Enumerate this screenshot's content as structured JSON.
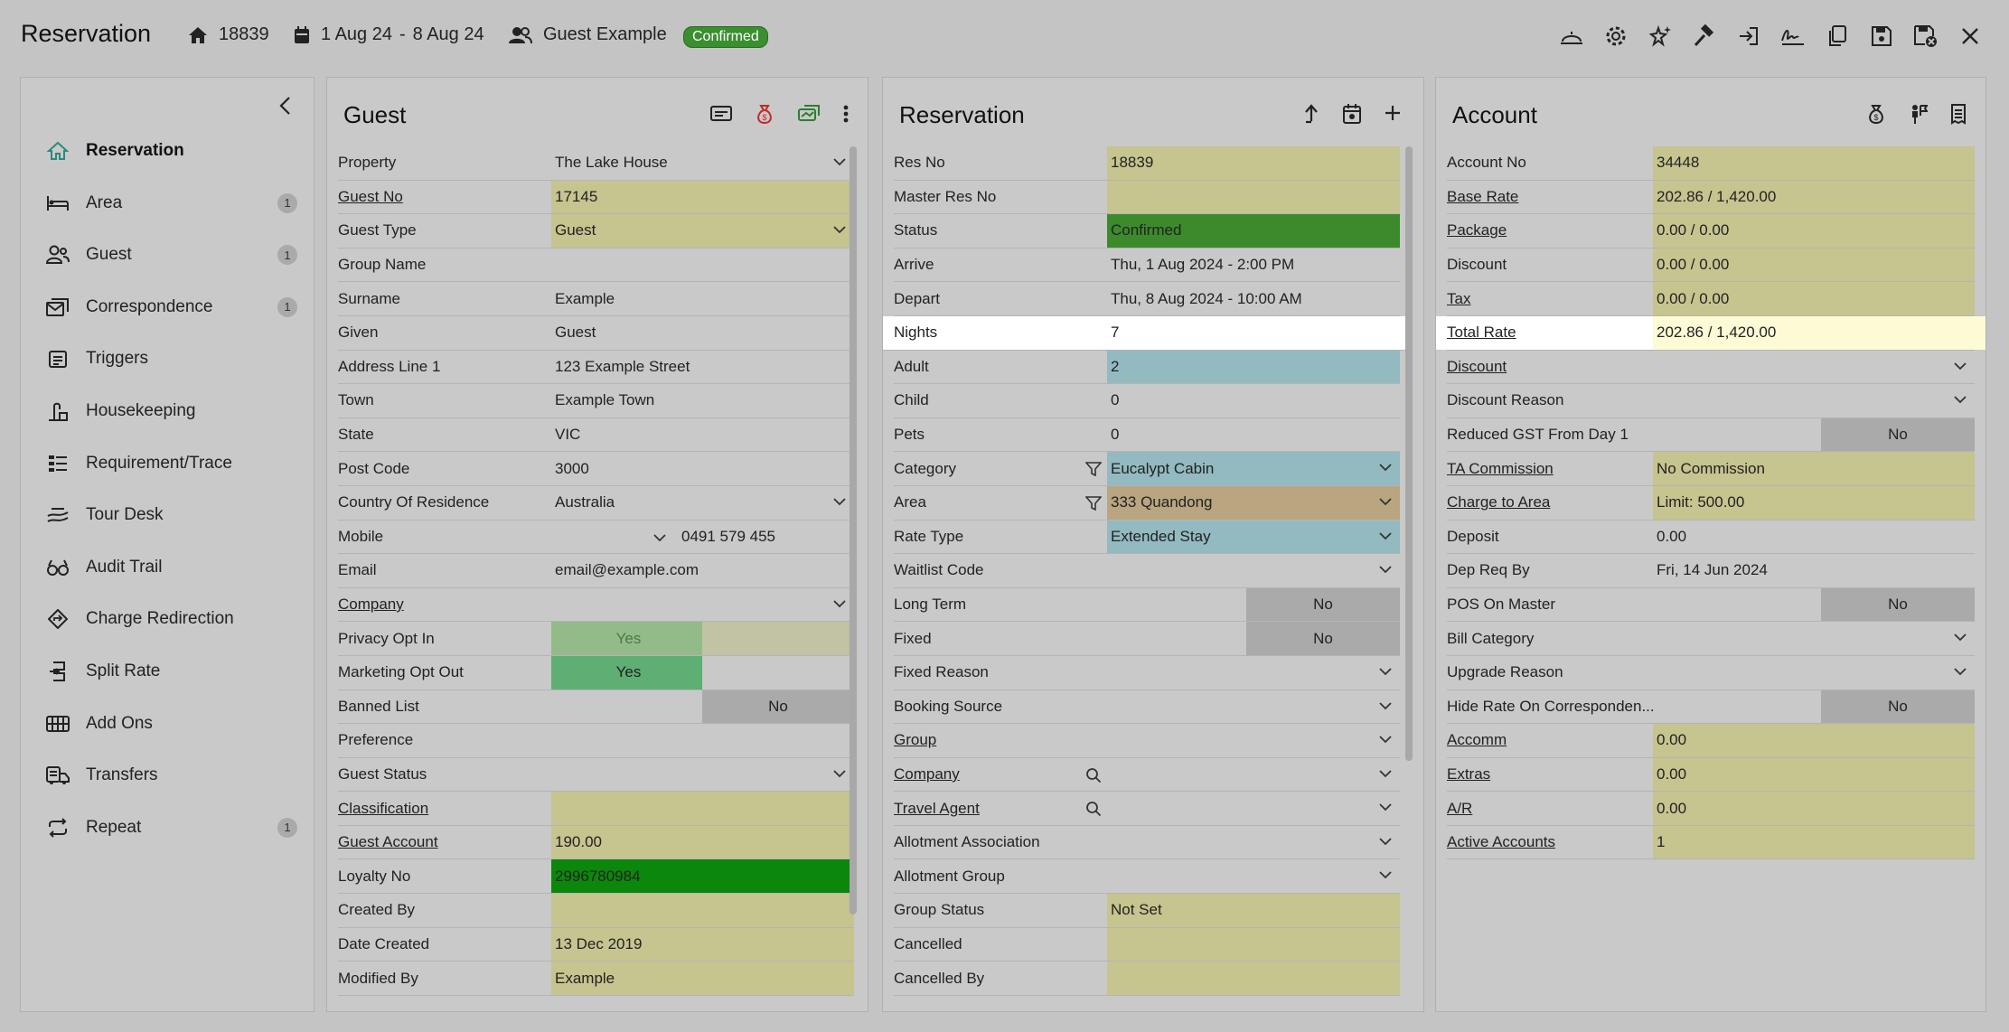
{
  "header": {
    "title": "Reservation",
    "res_no": "18839",
    "date_from": "1 Aug 24",
    "date_sep": "-",
    "date_to": "8 Aug 24",
    "guest": "Guest Example",
    "status": "Confirmed"
  },
  "nav": {
    "items": [
      {
        "label": "Reservation",
        "icon": "home-icon",
        "count": ""
      },
      {
        "label": "Area",
        "icon": "bed-icon",
        "count": "1"
      },
      {
        "label": "Guest",
        "icon": "users-icon",
        "count": "1"
      },
      {
        "label": "Correspondence",
        "icon": "envelope-icon",
        "count": "1"
      },
      {
        "label": "Triggers",
        "icon": "calendar-list-icon",
        "count": ""
      },
      {
        "label": "Housekeeping",
        "icon": "housekeeping-icon",
        "count": ""
      },
      {
        "label": "Requirement/Trace",
        "icon": "list-icon",
        "count": ""
      },
      {
        "label": "Tour Desk",
        "icon": "map-icon",
        "count": ""
      },
      {
        "label": "Audit Trail",
        "icon": "glasses-icon",
        "count": ""
      },
      {
        "label": "Charge Redirection",
        "icon": "diamond-arrow-icon",
        "count": ""
      },
      {
        "label": "Split Rate",
        "icon": "split-icon",
        "count": ""
      },
      {
        "label": "Add Ons",
        "icon": "grid-icon",
        "count": ""
      },
      {
        "label": "Transfers",
        "icon": "bus-icon",
        "count": ""
      },
      {
        "label": "Repeat",
        "icon": "repeat-icon",
        "count": "1"
      }
    ]
  },
  "guest": {
    "title": "Guest",
    "rows": [
      {
        "label": "Property",
        "value": "The Lake House",
        "style": "",
        "chev": true,
        "u": false
      },
      {
        "label": "Guest No",
        "value": "17145",
        "style": "yel",
        "chev": false,
        "u": true
      },
      {
        "label": "Guest Type",
        "value": "Guest",
        "style": "yel",
        "chev": true,
        "u": false
      },
      {
        "label": "Group Name",
        "value": "",
        "style": "",
        "chev": false,
        "u": false
      },
      {
        "label": "Surname",
        "value": "Example",
        "style": "",
        "chev": false,
        "u": false
      },
      {
        "label": "Given",
        "value": "Guest",
        "style": "",
        "chev": false,
        "u": false
      },
      {
        "label": "Address Line 1",
        "value": "123 Example Street",
        "style": "",
        "chev": false,
        "u": false
      },
      {
        "label": "Town",
        "value": "Example Town",
        "style": "",
        "chev": false,
        "u": false
      },
      {
        "label": "State",
        "value": "VIC",
        "style": "",
        "chev": false,
        "u": false
      },
      {
        "label": "Post Code",
        "value": "3000",
        "style": "",
        "chev": false,
        "u": false
      },
      {
        "label": "Country Of Residence",
        "value": "Australia",
        "style": "",
        "chev": true,
        "u": false
      },
      {
        "label": "Mobile",
        "value": "0491 579 455",
        "style": "mobile",
        "chev": false,
        "u": false
      },
      {
        "label": "Email",
        "value": "email@example.com",
        "style": "",
        "chev": false,
        "u": false
      },
      {
        "label": "Company",
        "value": "",
        "style": "",
        "chev": true,
        "u": true
      },
      {
        "label": "Privacy Opt In",
        "value": "Yes",
        "style": "privacy",
        "chev": false,
        "u": false
      },
      {
        "label": "Marketing Opt Out",
        "value": "Yes",
        "style": "marketing",
        "chev": false,
        "u": false
      },
      {
        "label": "Banned List",
        "value": "No",
        "style": "banned",
        "chev": false,
        "u": false
      },
      {
        "label": "Preference",
        "value": "",
        "style": "",
        "chev": false,
        "u": false
      },
      {
        "label": "Guest Status",
        "value": "",
        "style": "",
        "chev": true,
        "u": false
      },
      {
        "label": "Classification",
        "value": "",
        "style": "yel",
        "chev": false,
        "u": true
      },
      {
        "label": "Guest Account",
        "value": "190.00",
        "style": "yel",
        "chev": false,
        "u": true
      },
      {
        "label": "Loyalty No",
        "value": "2996780984",
        "style": "dgrn",
        "chev": false,
        "u": false
      },
      {
        "label": "Created By",
        "value": "",
        "style": "yel",
        "chev": false,
        "u": false
      },
      {
        "label": "Date Created",
        "value": "13 Dec 2019",
        "style": "yel",
        "chev": false,
        "u": false
      },
      {
        "label": "Modified By",
        "value": "Example",
        "style": "yel",
        "chev": false,
        "u": false
      }
    ]
  },
  "reservation": {
    "title": "Reservation",
    "rows": [
      {
        "label": "Res No",
        "value": "18839",
        "style": "yel",
        "chev": false,
        "u": false
      },
      {
        "label": "Master Res No",
        "value": "",
        "style": "yel",
        "chev": false,
        "u": false
      },
      {
        "label": "Status",
        "value": "Confirmed",
        "style": "grn",
        "chev": false,
        "u": false
      },
      {
        "label": "Arrive",
        "value": "Thu, 1 Aug 2024 - 2:00 PM",
        "style": "",
        "chev": false,
        "u": false
      },
      {
        "label": "Depart",
        "value": "Thu, 8 Aug 2024 - 10:00 AM",
        "style": "",
        "chev": false,
        "u": false
      },
      {
        "label": "Nights",
        "value": "7",
        "style": "hlrow",
        "chev": false,
        "u": false
      },
      {
        "label": "Adult",
        "value": "2",
        "style": "blu",
        "chev": false,
        "u": false
      },
      {
        "label": "Child",
        "value": "0",
        "style": "",
        "chev": false,
        "u": false
      },
      {
        "label": "Pets",
        "value": "0",
        "style": "",
        "chev": false,
        "u": false
      },
      {
        "label": "Category",
        "value": "Eucalypt Cabin",
        "style": "blu-f",
        "chev": true,
        "u": false
      },
      {
        "label": "Area",
        "value": "333 Quandong",
        "style": "brn-f",
        "chev": true,
        "u": false
      },
      {
        "label": "Rate Type",
        "value": "Extended Stay",
        "style": "blu",
        "chev": true,
        "u": false
      },
      {
        "label": "Waitlist Code",
        "value": "",
        "style": "",
        "chev": true,
        "u": false
      },
      {
        "label": "Long Term",
        "value": "No",
        "style": "no",
        "chev": false,
        "u": false
      },
      {
        "label": "Fixed",
        "value": "No",
        "style": "no",
        "chev": false,
        "u": false
      },
      {
        "label": "Fixed Reason",
        "value": "",
        "style": "",
        "chev": true,
        "u": false
      },
      {
        "label": "Booking Source",
        "value": "",
        "style": "",
        "chev": true,
        "u": false
      },
      {
        "label": "Group",
        "value": "",
        "style": "",
        "chev": true,
        "u": true
      },
      {
        "label": "Company",
        "value": "",
        "style": "search",
        "chev": true,
        "u": true
      },
      {
        "label": "Travel Agent",
        "value": "",
        "style": "search",
        "chev": true,
        "u": true
      },
      {
        "label": "Allotment Association",
        "value": "",
        "style": "",
        "chev": true,
        "u": false
      },
      {
        "label": "Allotment Group",
        "value": "",
        "style": "",
        "chev": true,
        "u": false
      },
      {
        "label": "Group Status",
        "value": "Not Set",
        "style": "yel",
        "chev": false,
        "u": false
      },
      {
        "label": "Cancelled",
        "value": "",
        "style": "yel",
        "chev": false,
        "u": false
      },
      {
        "label": "Cancelled By",
        "value": "",
        "style": "yel",
        "chev": false,
        "u": false
      }
    ]
  },
  "account": {
    "title": "Account",
    "rows": [
      {
        "label": "Account No",
        "value": "34448",
        "style": "yel",
        "chev": false,
        "u": false
      },
      {
        "label": "Base Rate",
        "value": "202.86 / 1,420.00",
        "style": "yel",
        "chev": false,
        "u": true
      },
      {
        "label": "Package",
        "value": "0.00 / 0.00",
        "style": "yel",
        "chev": false,
        "u": true
      },
      {
        "label": "Discount",
        "value": "0.00 / 0.00",
        "style": "yel",
        "chev": false,
        "u": false
      },
      {
        "label": "Tax",
        "value": "0.00 / 0.00",
        "style": "yel",
        "chev": false,
        "u": true
      },
      {
        "label": "Total Rate",
        "value": "202.86 / 1,420.00",
        "style": "hltotal",
        "chev": false,
        "u": true
      },
      {
        "label": "Discount",
        "value": "",
        "style": "",
        "chev": true,
        "u": true
      },
      {
        "label": "Discount Reason",
        "value": "",
        "style": "",
        "chev": true,
        "u": false
      },
      {
        "label": "Reduced GST From Day 1",
        "value": "No",
        "style": "no",
        "chev": false,
        "u": false
      },
      {
        "label": "TA Commission",
        "value": "No Commission",
        "style": "yel",
        "chev": false,
        "u": true
      },
      {
        "label": "Charge to Area",
        "value": "Limit: 500.00",
        "style": "yel",
        "chev": false,
        "u": true
      },
      {
        "label": "Deposit",
        "value": "0.00",
        "style": "",
        "chev": false,
        "u": false
      },
      {
        "label": "Dep Req By",
        "value": "Fri, 14 Jun 2024",
        "style": "",
        "chev": false,
        "u": false
      },
      {
        "label": "POS On Master",
        "value": "No",
        "style": "no",
        "chev": false,
        "u": false
      },
      {
        "label": "Bill Category",
        "value": "",
        "style": "",
        "chev": true,
        "u": false
      },
      {
        "label": "Upgrade Reason",
        "value": "",
        "style": "",
        "chev": true,
        "u": false
      },
      {
        "label": "Hide Rate On Corresponden...",
        "value": "No",
        "style": "no",
        "chev": false,
        "u": false
      },
      {
        "label": "Accomm",
        "value": "0.00",
        "style": "yel",
        "chev": false,
        "u": true
      },
      {
        "label": "Extras",
        "value": "0.00",
        "style": "yel",
        "chev": false,
        "u": true
      },
      {
        "label": "A/R",
        "value": "0.00",
        "style": "yel",
        "chev": false,
        "u": true
      },
      {
        "label": "Active Accounts",
        "value": "1",
        "style": "yel",
        "chev": false,
        "u": true
      }
    ]
  }
}
